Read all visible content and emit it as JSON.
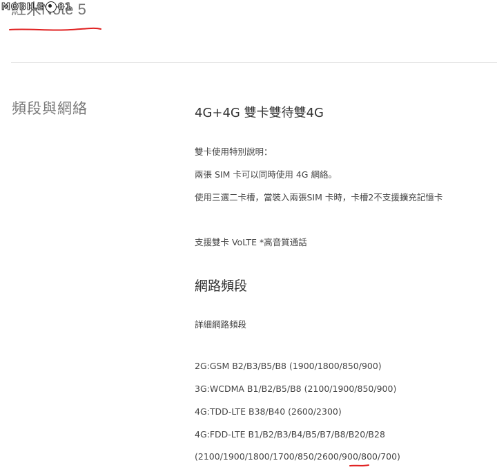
{
  "watermark": {
    "text_left": "MOBILE",
    "text_right": "01"
  },
  "product": {
    "title": "紅米Note 5"
  },
  "section": {
    "heading": "頻段與網絡"
  },
  "dual_sim": {
    "title": "4G+4G 雙卡雙待雙4G",
    "lines": [
      "雙卡使用特別說明：",
      "兩張 SIM 卡可以同時使用 4G 網絡。",
      "使用三選二卡槽，當裝入兩張SIM 卡時，卡槽2不支援擴充記憶卡"
    ],
    "volte": "支援雙卡 VoLTE *高音質通話"
  },
  "network": {
    "title": "網路頻段",
    "subtitle": "詳細網路頻段",
    "bands": [
      "2G:GSM B2/B3/B5/B8 (1900/1800/850/900)",
      "3G:WCDMA B1/B2/B5/B8 (2100/1900/850/900)",
      "4G:TDD-LTE B38/B40 (2600/2300)",
      "4G:FDD-LTE B1/B2/B3/B4/B5/B7/B8/B20/B28",
      "(2100/1900/1800/1700/850/2600/900/800/700)"
    ]
  },
  "colors": {
    "annotation_red": "#e02020",
    "divider": "#e6e6e6"
  }
}
